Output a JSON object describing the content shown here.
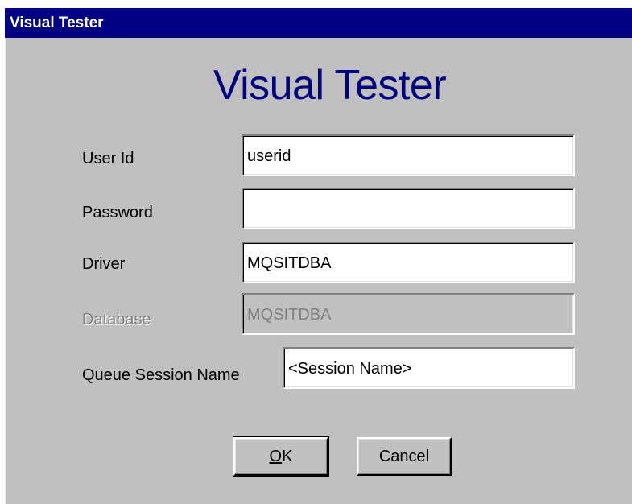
{
  "window": {
    "title": "Visual Tester"
  },
  "dialog": {
    "heading": "Visual Tester",
    "fields": {
      "user_id": {
        "label": "User Id",
        "value": "userid"
      },
      "password": {
        "label": "Password",
        "value": ""
      },
      "driver": {
        "label": "Driver",
        "value": "MQSITDBA"
      },
      "database": {
        "label": "Database",
        "value": "MQSITDBA",
        "disabled": true
      },
      "queue_session_name": {
        "label": "Queue Session Name",
        "value": "<Session Name>"
      }
    },
    "buttons": {
      "ok_label": "OK",
      "cancel_label": "Cancel"
    }
  },
  "colors": {
    "titlebar": "#000080",
    "heading": "#000080",
    "dialog_face": "#c0c0c0",
    "disabled_text": "#808080"
  }
}
